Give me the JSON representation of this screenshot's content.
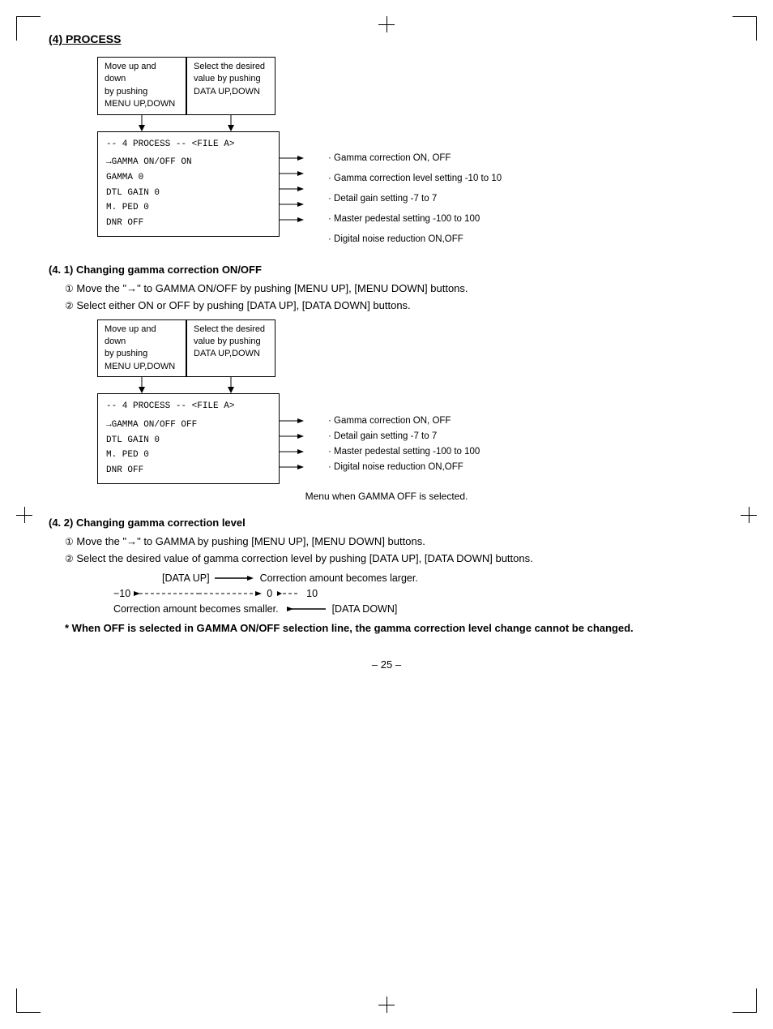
{
  "page": {
    "title": "(4)  PROCESS",
    "page_number": "– 25 –"
  },
  "diagram1": {
    "box_left_line1": "Move up and down",
    "box_left_line2": "by pushing",
    "box_left_line3": "MENU UP,DOWN",
    "box_right_line1": "Select the desired",
    "box_right_line2": "value by pushing",
    "box_right_line3": "DATA UP,DOWN",
    "menu_title": "-- 4  PROCESS --  <FILE A>",
    "menu_line1": "→GAMMA ON/OFF    ON",
    "menu_line2": "  GAMMA          0",
    "menu_line3": "  DTL GAIN       0",
    "menu_line4": "  M. PED         0",
    "menu_line5": "  DNR         OFF",
    "annot1": "· Gamma correction   ON, OFF",
    "annot2": "· Gamma correction level setting   -10 to 10",
    "annot3": "· Detail gain setting   -7 to 7",
    "annot4": "· Master pedestal setting   -100 to 100",
    "annot5": "· Digital noise reduction   ON,OFF"
  },
  "section_4_1": {
    "title": "(4. 1)  Changing gamma correction ON/OFF",
    "step1": "Move the \"→\" to GAMMA ON/OFF by pushing [MENU UP], [MENU DOWN] buttons.",
    "step2": "Select either ON or OFF by pushing [DATA UP], [DATA DOWN] buttons.",
    "box_left_line1": "Move up and down",
    "box_left_line2": "by pushing",
    "box_left_line3": "MENU UP,DOWN",
    "box_right_line1": "Select the desired",
    "box_right_line2": "value by pushing",
    "box_right_line3": "DATA UP,DOWN",
    "menu_title": "-- 4  PROCESS --  <FILE A>",
    "menu_line1": "→GAMMA ON/OFF  OFF",
    "menu_line2": "  DTL GAIN       0",
    "menu_line3": "  M. PED         0",
    "menu_line4": "  DNR         OFF",
    "annot1": "· Gamma correction   ON, OFF",
    "annot2": "· Detail gain setting   -7 to 7",
    "annot3": "· Master pedestal setting   -100 to 100",
    "annot4": "· Digital noise reduction   ON,OFF",
    "caption": "Menu when GAMMA OFF is selected."
  },
  "section_4_2": {
    "title": "(4. 2)  Changing gamma correction level",
    "step1": "Move the \"→\" to GAMMA by pushing [MENU UP], [MENU DOWN] buttons.",
    "step2": "Select the desired value of gamma correction level by pushing [DATA UP], [DATA DOWN] buttons.",
    "data_up_label": "[DATA UP]",
    "data_up_desc": "Correction amount becomes larger.",
    "scale_left": "−10",
    "scale_right": "10",
    "scale_mid": "0",
    "data_down_label": "[DATA DOWN]",
    "data_down_desc": "Correction amount becomes smaller.",
    "warning": "* When OFF is selected in GAMMA ON/OFF selection line, the gamma correction level change cannot be changed."
  }
}
